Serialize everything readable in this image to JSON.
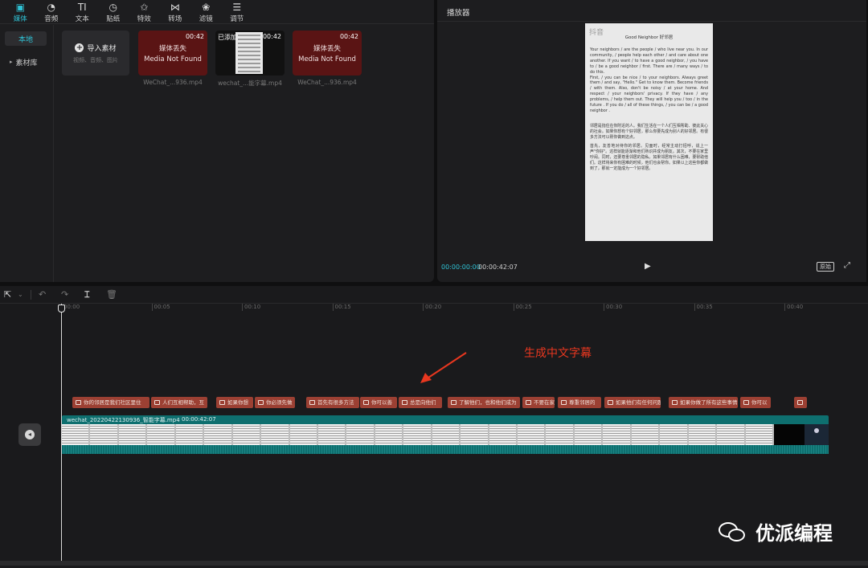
{
  "topnav": [
    {
      "label": "媒体",
      "icon": "media-icon",
      "glyph": "▣",
      "active": true
    },
    {
      "label": "音频",
      "icon": "audio-icon",
      "glyph": "◔",
      "active": false
    },
    {
      "label": "文本",
      "icon": "text-icon",
      "glyph": "TI",
      "active": false
    },
    {
      "label": "贴纸",
      "icon": "sticker-icon",
      "glyph": "◷",
      "active": false
    },
    {
      "label": "特效",
      "icon": "effects-icon",
      "glyph": "✩",
      "active": false
    },
    {
      "label": "转场",
      "icon": "transition-icon",
      "glyph": "⋈",
      "active": false
    },
    {
      "label": "滤镜",
      "icon": "filter-icon",
      "glyph": "❀",
      "active": false
    },
    {
      "label": "调节",
      "icon": "adjust-icon",
      "glyph": "☰",
      "active": false
    }
  ],
  "sidebar": {
    "local": "本地",
    "library": "素材库"
  },
  "import_card": {
    "label": "导入素材",
    "sub": "视频、音频、图片"
  },
  "clips": [
    {
      "name": "WeChat_...936.mp4",
      "duration": "00:42",
      "missing_cn": "媒体丢失",
      "missing_en": "Media Not Found"
    },
    {
      "name": "wechat_...能字幕.mp4",
      "duration": "00:42",
      "added": "已添加"
    },
    {
      "name": "WeChat_...936.mp4",
      "duration": "00:42",
      "missing_cn": "媒体丢失",
      "missing_en": "Media Not Found"
    }
  ],
  "player": {
    "title": "播放器",
    "current_time": "00:00:00:00",
    "total_time": "00:00:42:07",
    "ratio_label": "原始",
    "video_logo": "抖音",
    "video_heading": "Good Neighbor  好邻居",
    "paragraphs_en": [
      "Your neighbors / are the people / who live near you. In our community, / people help each other / and care about one another. If you want / to have a good neighbor, / you have to / be a good neighbor / first. There are / many ways / to do this.",
      "First, / you can be nice / to your neighbors. Always greet them / and say, \"Hello.\" Get to know them. Become friends / with them. Also, don't be noisy / at your home. And respect / your neighbors' privacy. If they have / any problems, / help them out. They will help you / too / in the future . If you do / all of these things, / you can be / a good neighbor ."
    ],
    "paragraphs_cn": [
      "邻居是指住在你附近的人。我们生活在一个人们互相帮助、彼此关心的社会。如果你想有个好邻居，那么你要先成为别人的好邻居。有很多方法可以帮你做到这点。",
      "首先，友善地对待你的邻居。见面时，经常主动打招呼，说上一声\"你好\"。这样就能逐渐和他们熟识并成为朋友。其次，不要在家里吵闹。同时，还要尊重邻居的隐私。如果邻居有什么困难，要帮助他们。这样将来你有困难的时候，他们也会帮你。如果以上这些你都做到了，那就一定能成为一个好邻居。"
    ]
  },
  "timeline": {
    "ticks": [
      "00:00",
      "00:05",
      "00:10",
      "00:15",
      "00:20",
      "00:25",
      "00:30",
      "00:35",
      "00:40"
    ],
    "annotation": "生成中文字幕",
    "captions": [
      "你的邻居是我们社区里住",
      "人们互相帮助，互",
      "如果你想",
      "你必须先做",
      "首先有很多方法",
      "你可以善",
      "总是向他们",
      "了解他们，也和他们成为",
      "不要在家",
      "尊重邻居的",
      "如果他们有任何问题",
      "如果你做了所有这些事情",
      "你可以",
      ""
    ],
    "main_clip": {
      "name": "wechat_20220422130936_智能字幕.mp4",
      "duration": "00:00:42:07"
    }
  },
  "watermark": "优派编程"
}
